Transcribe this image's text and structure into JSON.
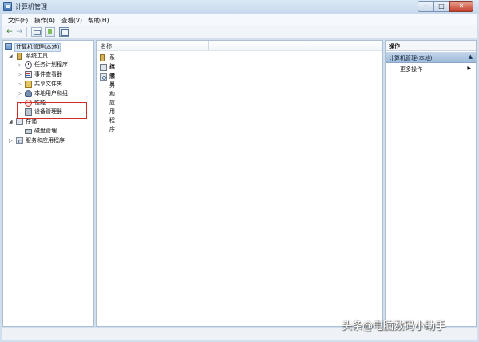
{
  "window": {
    "title": "计算机管理",
    "controls": {
      "minimize": "─",
      "maximize": "□",
      "close": "✕"
    }
  },
  "menu": {
    "items": [
      {
        "label": "文件(F)"
      },
      {
        "label": "操作(A)"
      },
      {
        "label": "查看(V)"
      },
      {
        "label": "帮助(H)"
      }
    ]
  },
  "toolbar": {
    "back_icon": "←",
    "forward_icon": "→",
    "buttons": [
      "console-tree-icon",
      "help-icon",
      "view-icon"
    ]
  },
  "tree": {
    "root": "计算机管理(本地)",
    "system_tools": {
      "label": "系统工具",
      "children": [
        {
          "label": "任务计划程序",
          "icon": "clock-icon"
        },
        {
          "label": "事件查看器",
          "icon": "event-viewer-icon"
        },
        {
          "label": "共享文件夹",
          "icon": "shared-folder-icon"
        },
        {
          "label": "本地用户和组",
          "icon": "users-icon"
        },
        {
          "label": "性能",
          "icon": "performance-icon"
        },
        {
          "label": "设备管理器",
          "icon": "device-manager-icon"
        }
      ]
    },
    "storage": {
      "label": "存储",
      "children": [
        {
          "label": "磁盘管理",
          "icon": "disk-icon"
        }
      ]
    },
    "services": {
      "label": "服务和应用程序"
    }
  },
  "list": {
    "column_name": "名称",
    "rows": [
      {
        "label": "系统工具",
        "icon": "tools-icon"
      },
      {
        "label": "存储",
        "icon": "storage-icon"
      },
      {
        "label": "服务和应用程序",
        "icon": "services-icon"
      }
    ]
  },
  "actions": {
    "title": "操作",
    "section": "计算机管理(本地)",
    "collapse_icon": "▲",
    "more_actions": "更多操作",
    "more_arrow": "▶"
  },
  "watermark": "头条@电脑数码小助手",
  "colors": {
    "highlight": "#d42a2a",
    "titlebar": "#c6d8ec",
    "close_button": "#c5402b"
  }
}
